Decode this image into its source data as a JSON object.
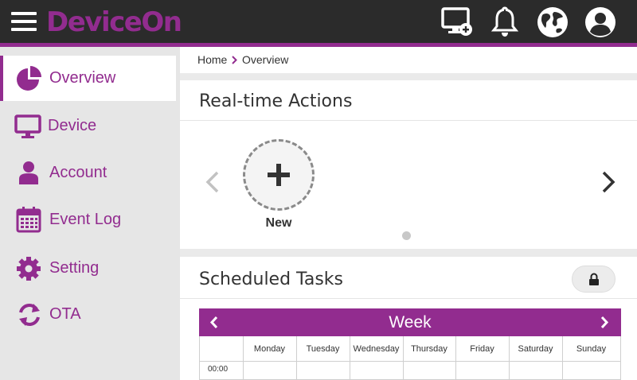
{
  "header": {
    "brand": "DeviceOn",
    "icons": [
      "menu-icon",
      "add-device-icon",
      "bell-icon",
      "globe-icon",
      "user-icon"
    ]
  },
  "sidebar": {
    "items": [
      {
        "label": "Overview",
        "icon": "pie-chart-icon",
        "active": true
      },
      {
        "label": "Device",
        "icon": "monitor-icon"
      },
      {
        "label": "Account",
        "icon": "person-icon"
      },
      {
        "label": "Event Log",
        "icon": "calendar-icon"
      },
      {
        "label": "Setting",
        "icon": "gear-icon"
      },
      {
        "label": "OTA",
        "icon": "refresh-icon"
      }
    ]
  },
  "breadcrumb": {
    "home": "Home",
    "current": "Overview"
  },
  "realtime": {
    "title": "Real-time Actions",
    "new_label": "New"
  },
  "scheduled": {
    "title": "Scheduled Tasks",
    "calendar": {
      "title": "Week",
      "days": [
        "Monday",
        "Tuesday",
        "Wednesday",
        "Thursday",
        "Friday",
        "Saturday",
        "Sunday"
      ],
      "first_time": "00:00"
    }
  },
  "colors": {
    "accent": "#922c8f",
    "topbar": "#2b2b2b",
    "sidebar": "#e6e6e6"
  }
}
